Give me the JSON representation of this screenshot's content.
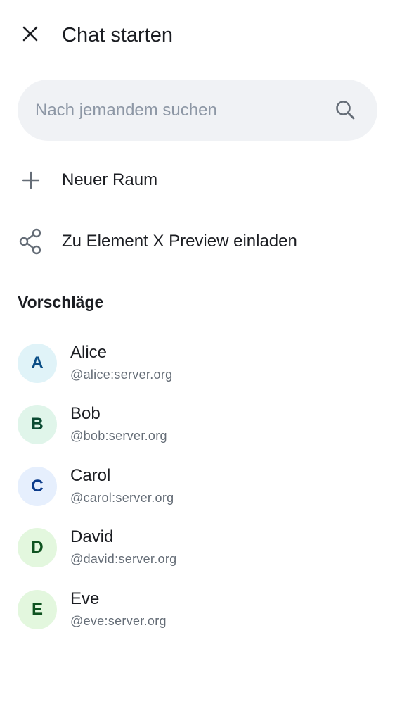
{
  "header": {
    "close_icon": "close-icon",
    "title": "Chat starten"
  },
  "search": {
    "placeholder": "Nach jemandem suchen",
    "value": "",
    "icon": "search-icon"
  },
  "actions": [
    {
      "icon": "plus-icon",
      "label": "Neuer Raum"
    },
    {
      "icon": "share-icon",
      "label": "Zu Element X Preview einladen"
    }
  ],
  "suggestions": {
    "header": "Vorschläge",
    "users": [
      {
        "initial": "A",
        "name": "Alice",
        "id": "@alice:server.org",
        "avatar_bg": "#e0f3f8",
        "avatar_fg": "#0a4e86"
      },
      {
        "initial": "B",
        "name": "Bob",
        "id": "@bob:server.org",
        "avatar_bg": "#e0f5ea",
        "avatar_fg": "#0b4a33"
      },
      {
        "initial": "C",
        "name": "Carol",
        "id": "@carol:server.org",
        "avatar_bg": "#e6effd",
        "avatar_fg": "#0a3a8a"
      },
      {
        "initial": "D",
        "name": "David",
        "id": "@david:server.org",
        "avatar_bg": "#e3f7de",
        "avatar_fg": "#0f5320"
      },
      {
        "initial": "E",
        "name": "Eve",
        "id": "@eve:server.org",
        "avatar_bg": "#e3f7de",
        "avatar_fg": "#0f5320"
      }
    ]
  },
  "colors": {
    "text_primary": "#1b1d22",
    "text_secondary": "#656d77",
    "search_bg": "#f0f2f5",
    "placeholder": "#8d97a5",
    "icon": "#656d77"
  }
}
